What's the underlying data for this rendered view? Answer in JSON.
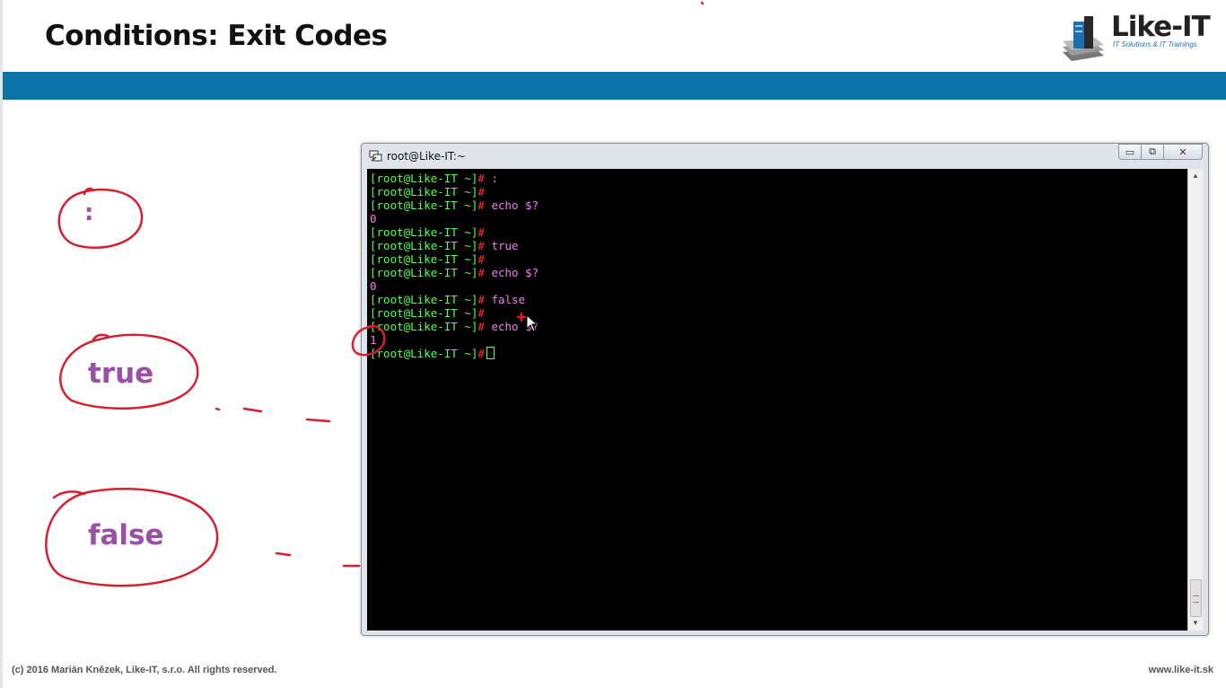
{
  "slide": {
    "title": "Conditions: Exit Codes",
    "logo": {
      "name": "Like-IT",
      "tagline": "IT Solutions & IT Trainings"
    },
    "labels": {
      "colon": ":",
      "true_cmd": "true",
      "false_cmd": "false"
    },
    "footer": {
      "copyright": "(c) 2016 Marián Knězek, Like-IT, s.r.o. All rights reserved.",
      "website": "www.like-it.sk"
    }
  },
  "window": {
    "title": "root@Like-IT:~",
    "icon": "putty-icon",
    "controls": {
      "minimize": "▭",
      "maximize": "⧉",
      "close": "✕"
    }
  },
  "terminal": {
    "prompt": "[root@Like-IT ~]",
    "hash": "#",
    "lines": [
      {
        "type": "cmd",
        "text": " :"
      },
      {
        "type": "cmd",
        "text": ""
      },
      {
        "type": "cmd",
        "text": " echo $?"
      },
      {
        "type": "out",
        "text": "0"
      },
      {
        "type": "cmd",
        "text": ""
      },
      {
        "type": "cmd",
        "text": " true"
      },
      {
        "type": "cmd",
        "text": ""
      },
      {
        "type": "cmd",
        "text": " echo $?"
      },
      {
        "type": "out",
        "text": "0"
      },
      {
        "type": "cmd",
        "text": " false"
      },
      {
        "type": "cmd",
        "text": ""
      },
      {
        "type": "cmd",
        "text": " echo $?"
      },
      {
        "type": "out",
        "text": "1"
      },
      {
        "type": "cursor",
        "text": " "
      }
    ]
  },
  "colors": {
    "header_bar": "#0b73a8",
    "label_purple": "#9b4fa6",
    "annotation_red": "#d42030",
    "prompt_green": "#55ff55",
    "command_magenta": "#f07ef0"
  }
}
